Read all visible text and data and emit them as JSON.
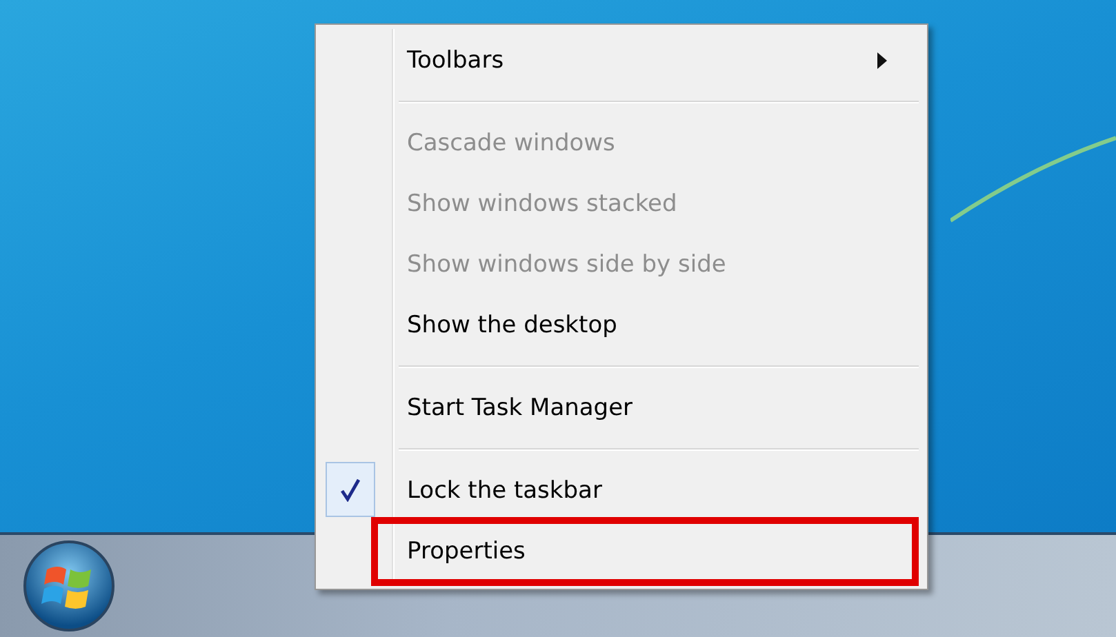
{
  "menu": {
    "items": [
      {
        "kind": "item",
        "label": "Toolbars",
        "disabled": false,
        "checked": false,
        "submenu": true,
        "highlighted": false
      },
      {
        "kind": "separator"
      },
      {
        "kind": "item",
        "label": "Cascade windows",
        "disabled": true,
        "checked": false,
        "submenu": false,
        "highlighted": false
      },
      {
        "kind": "item",
        "label": "Show windows stacked",
        "disabled": true,
        "checked": false,
        "submenu": false,
        "highlighted": false
      },
      {
        "kind": "item",
        "label": "Show windows side by side",
        "disabled": true,
        "checked": false,
        "submenu": false,
        "highlighted": false
      },
      {
        "kind": "item",
        "label": "Show the desktop",
        "disabled": false,
        "checked": false,
        "submenu": false,
        "highlighted": false
      },
      {
        "kind": "separator"
      },
      {
        "kind": "item",
        "label": "Start Task Manager",
        "disabled": false,
        "checked": false,
        "submenu": false,
        "highlighted": false
      },
      {
        "kind": "separator"
      },
      {
        "kind": "item",
        "label": "Lock the taskbar",
        "disabled": false,
        "checked": true,
        "submenu": false,
        "highlighted": false
      },
      {
        "kind": "item",
        "label": "Properties",
        "disabled": false,
        "checked": false,
        "submenu": false,
        "highlighted": true
      }
    ]
  }
}
